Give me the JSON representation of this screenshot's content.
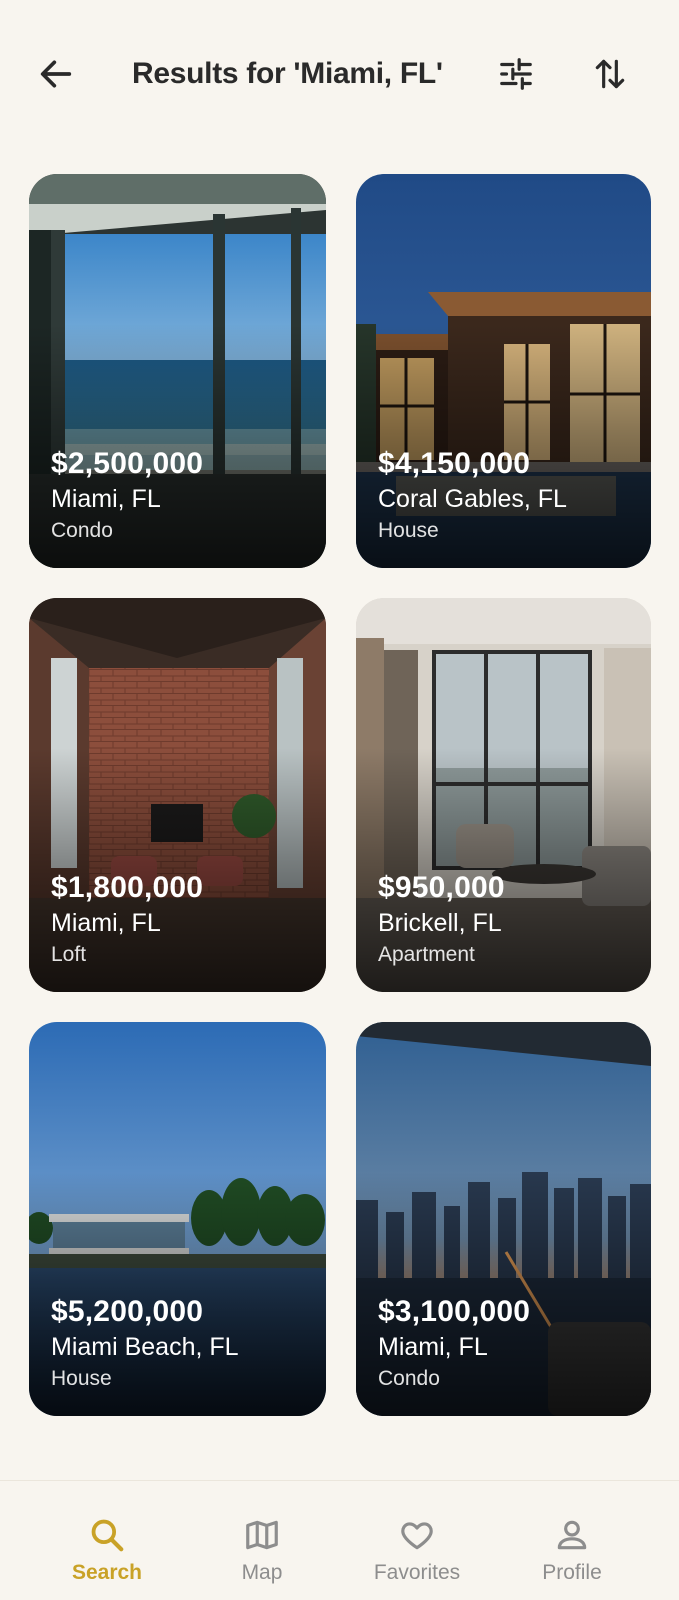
{
  "header": {
    "title": "Results for 'Miami, FL'",
    "back_icon": "arrow-left-icon",
    "filter_icon": "sliders-icon",
    "sort_icon": "sort-arrows-icon"
  },
  "listings": [
    {
      "price": "$2,500,000",
      "location": "Miami, FL",
      "type": "Condo"
    },
    {
      "price": "$4,150,000",
      "location": "Coral Gables, FL",
      "type": "House"
    },
    {
      "price": "$1,800,000",
      "location": "Miami, FL",
      "type": "Loft"
    },
    {
      "price": "$950,000",
      "location": "Brickell, FL",
      "type": "Apartment"
    },
    {
      "price": "$5,200,000",
      "location": "Miami Beach, FL",
      "type": "House"
    },
    {
      "price": "$3,100,000",
      "location": "Miami, FL",
      "type": "Condo"
    }
  ],
  "nav": {
    "items": [
      {
        "label": "Search",
        "icon": "search-icon",
        "active": true
      },
      {
        "label": "Map",
        "icon": "map-icon",
        "active": false
      },
      {
        "label": "Favorites",
        "icon": "heart-icon",
        "active": false
      },
      {
        "label": "Profile",
        "icon": "user-icon",
        "active": false
      }
    ]
  },
  "colors": {
    "background": "#f8f5ef",
    "accent": "#c9a227",
    "inactive": "#8d8d8d"
  }
}
